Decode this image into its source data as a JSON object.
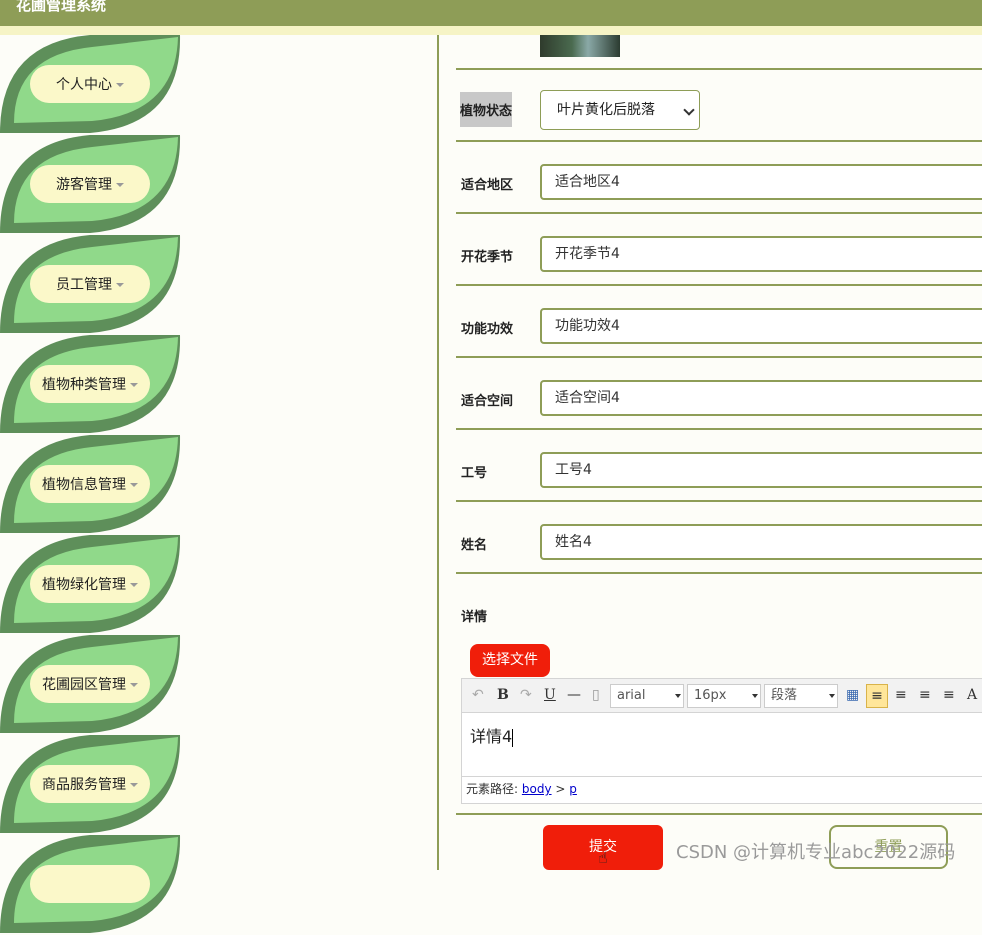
{
  "app": {
    "title": "花圃管理系统"
  },
  "sidebar": {
    "items": [
      {
        "label": "个人中心"
      },
      {
        "label": "游客管理"
      },
      {
        "label": "员工管理"
      },
      {
        "label": "植物种类管理"
      },
      {
        "label": "植物信息管理"
      },
      {
        "label": "植物绿化管理"
      },
      {
        "label": "花圃园区管理"
      },
      {
        "label": "商品服务管理"
      }
    ]
  },
  "form": {
    "status": {
      "label": "植物状态",
      "value": "叶片黄化后脱落"
    },
    "region": {
      "label": "适合地区",
      "value": "适合地区4"
    },
    "season": {
      "label": "开花季节",
      "value": "开花季节4"
    },
    "function": {
      "label": "功能功效",
      "value": "功能功效4"
    },
    "space": {
      "label": "适合空间",
      "value": "适合空间4"
    },
    "employee_id": {
      "label": "工号",
      "value": "工号4"
    },
    "name": {
      "label": "姓名",
      "value": "姓名4"
    },
    "detail": {
      "label": "详情",
      "value": "详情4"
    },
    "choose_file": "选择文件",
    "submit": "提交",
    "reset": "重置"
  },
  "editor": {
    "font": "arial",
    "size": "16px",
    "paragraph": "段落",
    "path_label": "元素路径:",
    "path_body": "body",
    "path_sep": ">",
    "path_p": "p"
  },
  "watermark": "CSDN @计算机专业abc2022源码",
  "colors": {
    "accent": "#8e9d57",
    "leaf_dark": "#5e8f5a",
    "leaf_light": "#90d98a",
    "pill": "#fbf8c9",
    "button": "#f01e0a"
  }
}
